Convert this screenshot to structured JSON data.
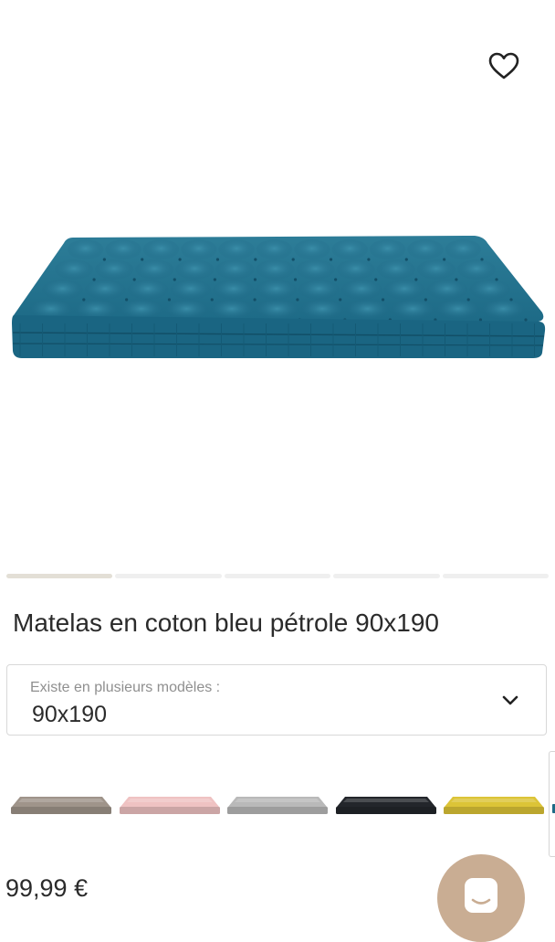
{
  "product": {
    "title": "Matelas en coton bleu pétrole 90x190",
    "price": "99,99 €",
    "image": {
      "description_icon": "mattress-image",
      "color": "#1f6f8b"
    }
  },
  "gallery": {
    "total_images": 5,
    "active_index": 0
  },
  "variant": {
    "caption": "Existe en plusieurs modèles :",
    "value": "90x190"
  },
  "swatches": [
    {
      "name": "swatch-taupe",
      "color": "#9f948a"
    },
    {
      "name": "swatch-pink",
      "color": "#efc2c2"
    },
    {
      "name": "swatch-grey",
      "color": "#b9b9b9"
    },
    {
      "name": "swatch-black",
      "color": "#23262b"
    },
    {
      "name": "swatch-yellow",
      "color": "#dcc437"
    }
  ],
  "colors": {
    "accent_chat": "#c9ad93",
    "text": "#2b2b2b",
    "muted_text": "#8f8f8f",
    "border": "#d8d8d8"
  },
  "icons": {
    "favorite": "heart-icon",
    "dropdown": "chevron-down-icon",
    "chat": "chat-icon"
  }
}
